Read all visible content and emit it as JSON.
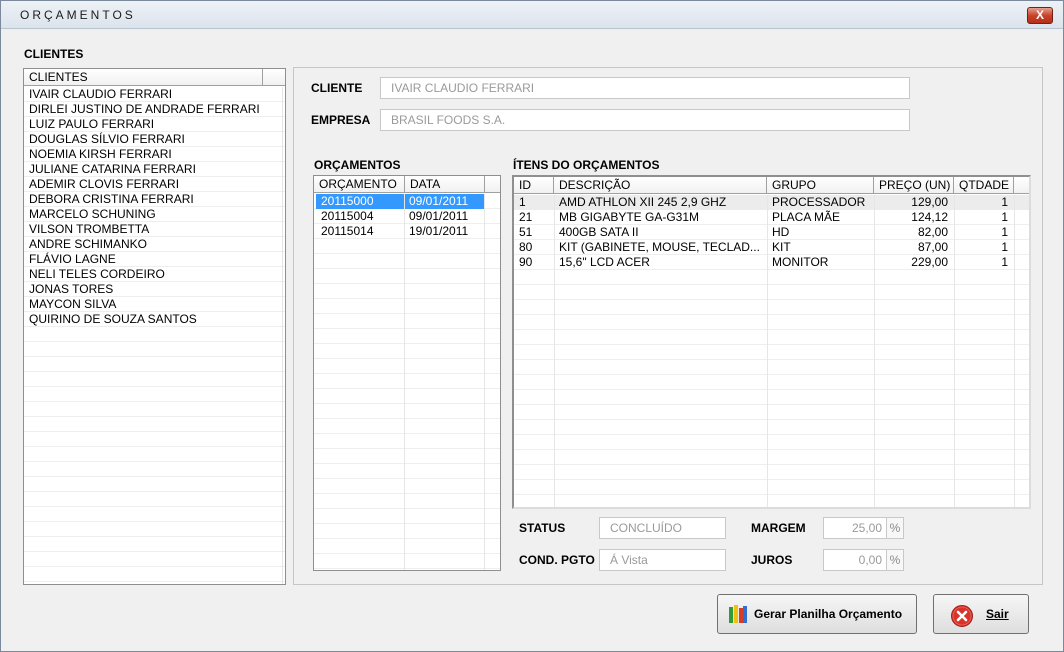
{
  "window": {
    "title": "ORÇAMENTOS",
    "close_glyph": "X"
  },
  "clientes": {
    "section_label": "CLIENTES",
    "column_header": "CLIENTES",
    "rows": [
      "IVAIR CLAUDIO FERRARI",
      "DIRLEI JUSTINO DE ANDRADE FERRARI",
      "LUIZ PAULO FERRARI",
      "DOUGLAS SÍLVIO FERRARI",
      "NOEMIA KIRSH FERRARI",
      "JULIANE CATARINA FERRARI",
      "ADEMIR CLOVIS FERRARI",
      "DEBORA CRISTINA FERRARI",
      "MARCELO SCHUNING",
      "VILSON TROMBETTA",
      "ANDRE SCHIMANKO",
      "FLÁVIO LAGNE",
      "NELI TELES CORDEIRO",
      "JONAS TORES",
      "MAYCON SILVA",
      "QUIRINO DE SOUZA SANTOS"
    ]
  },
  "cliente_label": "CLIENTE",
  "cliente_value": "IVAIR CLAUDIO FERRARI",
  "empresa_label": "EMPRESA",
  "empresa_value": "BRASIL FOODS S.A.",
  "orcamentos": {
    "section_label": "ORÇAMENTOS",
    "headers": [
      "ORÇAMENTO",
      "DATA"
    ],
    "rows": [
      {
        "orcamento": "20115000",
        "data": "09/01/2011",
        "selected": true
      },
      {
        "orcamento": "20115004",
        "data": "09/01/2011",
        "selected": false
      },
      {
        "orcamento": "20115014",
        "data": "19/01/2011",
        "selected": false
      }
    ]
  },
  "itens": {
    "section_label": "ÍTENS DO ORÇAMENTOS",
    "headers": [
      "ID",
      "DESCRIÇÃO",
      "GRUPO",
      "PREÇO (UN)",
      "QTDADE"
    ],
    "rows": [
      {
        "id": "1",
        "descricao": "AMD ATHLON XII 245 2,9 GHZ",
        "grupo": "PROCESSADOR",
        "preco": "129,00",
        "qtd": "1"
      },
      {
        "id": "21",
        "descricao": "MB GIGABYTE GA-G31M",
        "grupo": "PLACA MÃE",
        "preco": "124,12",
        "qtd": "1"
      },
      {
        "id": "51",
        "descricao": "400GB SATA II",
        "grupo": "HD",
        "preco": "82,00",
        "qtd": "1"
      },
      {
        "id": "80",
        "descricao": "KIT (GABINETE, MOUSE, TECLAD...",
        "grupo": "KIT",
        "preco": "87,00",
        "qtd": "1"
      },
      {
        "id": "90",
        "descricao": "15,6\" LCD ACER",
        "grupo": "MONITOR",
        "preco": "229,00",
        "qtd": "1"
      }
    ]
  },
  "status": {
    "label": "STATUS",
    "value": "CONCLUÍDO"
  },
  "cond_pgto": {
    "label": "COND. PGTO",
    "value": "Á Vista"
  },
  "margem": {
    "label": "MARGEM",
    "value": "25,00",
    "unit": "%"
  },
  "juros": {
    "label": "JUROS",
    "value": "0,00",
    "unit": "%"
  },
  "buttons": {
    "gerar_label": "Gerar Planilha Orçamento",
    "sair_label": "Sair"
  },
  "colors": {
    "selection": "#3399ff",
    "close_red": "#c8432b"
  }
}
